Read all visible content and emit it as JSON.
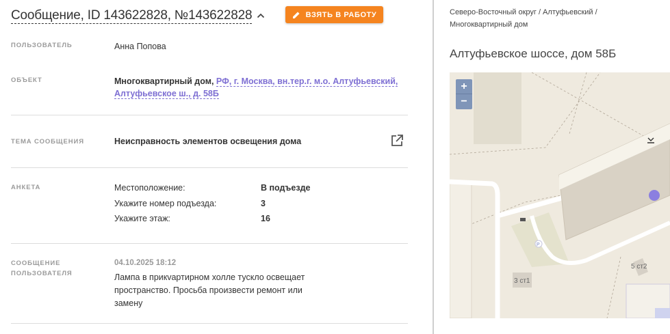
{
  "header": {
    "title": "Сообщение, ID 143622828, №143622828",
    "take_button": "ВЗЯТЬ В РАБОТУ"
  },
  "fields": {
    "user_label": "ПОЛЬЗОВАТЕЛЬ",
    "user_value": "Анна Попова",
    "object_label": "ОБЪЕКТ",
    "object_type": "Многоквартирный дом,",
    "object_address_line1": "РФ, г. Москва, вн.тер.г. м.о. Алтуфьевский,",
    "object_address_line2": "Алтуфьевское ш., д. 58Б",
    "topic_label": "ТЕМА СООБЩЕНИЯ",
    "topic_value": "Неисправность элементов освещения дома",
    "survey_label": "АНКЕТА",
    "message_label_line1": "СООБЩЕНИЕ",
    "message_label_line2": "ПОЛЬЗОВАТЕЛЯ",
    "message_date": "04.10.2025 18:12",
    "message_text": "Лампа в прикvартирном холле тускло освещает пространство. Просьба произвести ремонт или замену"
  },
  "survey": [
    {
      "question": "Местоположение:",
      "answer": "В подъезде"
    },
    {
      "question": "Укажите номер подъезда:",
      "answer": "3"
    },
    {
      "question": "Укажите этаж:",
      "answer": "16"
    }
  ],
  "location": {
    "breadcrumb_line1": "Северо-Восточный округ / Алтуфьевский /",
    "breadcrumb_line2": "Многоквартирный дом",
    "address": "Алтуфьевское шоссе, дом 58Б"
  },
  "map": {
    "zoom_in": "+",
    "zoom_out": "−",
    "label_building_a": "3 ст1",
    "label_building_b": "5 ст2",
    "label_parking": "P",
    "marker_color": "#8b7fe0"
  },
  "colors": {
    "accent": "#f5841f",
    "link": "#7e6fd3"
  }
}
